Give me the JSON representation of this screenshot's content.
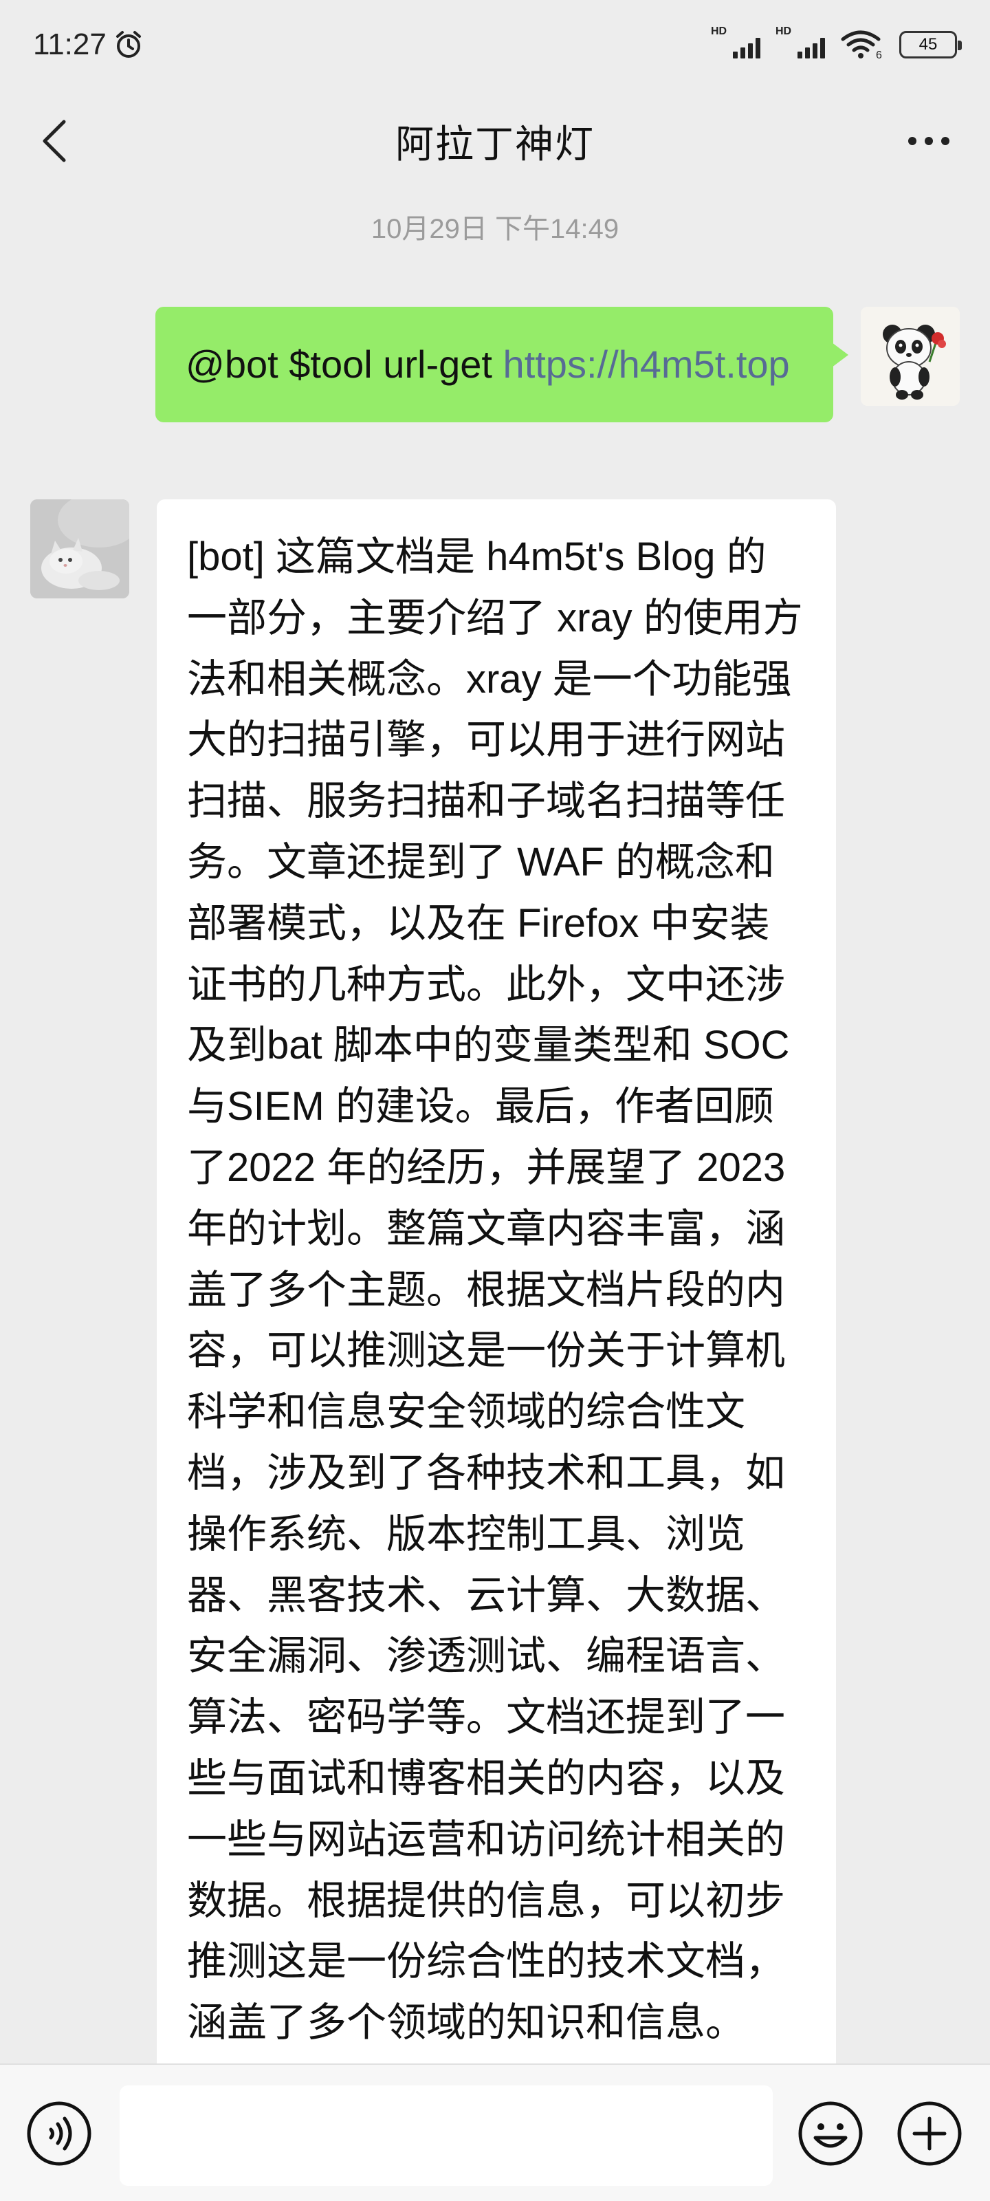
{
  "status_bar": {
    "time": "11:27",
    "signal1_label": "HD",
    "signal2_label": "HD",
    "wifi_label": "6",
    "battery": "45"
  },
  "header": {
    "title": "阿拉丁神灯"
  },
  "timestamp": "10月29日 下午14:49",
  "messages": [
    {
      "sender": "self",
      "text_prefix": "@bot $tool url-get ",
      "link": "https://h4m5t.top"
    },
    {
      "sender": "bot",
      "text": "[bot] 这篇文档是 h4m5t's Blog 的一部分，主要介绍了 xray 的使用方法和相关概念。xray 是一个功能强大的扫描引擎，可以用于进行网站扫描、服务扫描和子域名扫描等任务。文章还提到了 WAF 的概念和部署模式，以及在 Firefox 中安装证书的几种方式。此外，文中还涉及到bat 脚本中的变量类型和 SOC 与SIEM 的建设。最后，作者回顾了2022 年的经历，并展望了 2023 年的计划。整篇文章内容丰富，涵盖了多个主题。根据文档片段的内容，可以推测这是一份关于计算机科学和信息安全领域的综合性文档，涉及到了各种技术和工具，如操作系统、版本控制工具、浏览器、黑客技术、云计算、大数据、安全漏洞、渗透测试、编程语言、算法、密码学等。文档还提到了一些与面试和博客相关的内容，以及一些与网站运营和访问统计相关的数据。根据提供的信息，可以初步推测这是一份综合性的技术文档，涵盖了多个领域的知识和信息。"
    }
  ],
  "colors": {
    "background": "#ededed",
    "outgoing_bubble": "#95ec69",
    "incoming_bubble": "#ffffff",
    "link": "#576b95",
    "timestamp": "#9b9b9b"
  },
  "icons": {
    "back": "chevron-left-icon",
    "more": "more-dots-icon",
    "voice": "voice-icon",
    "emoji": "emoji-icon",
    "plus": "plus-icon"
  }
}
